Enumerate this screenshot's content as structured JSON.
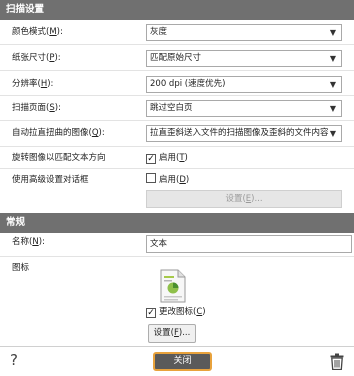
{
  "scan_settings": {
    "header": "扫描设置",
    "color_mode": {
      "label": "颜色模式(",
      "key": "M",
      "suffix": "):",
      "value": "灰度"
    },
    "paper_size": {
      "label": "纸张尺寸(",
      "key": "P",
      "suffix": "):",
      "value": "匹配原始尺寸"
    },
    "resolution": {
      "label": "分辨率(",
      "key": "H",
      "suffix": "):",
      "value": "200 dpi  (速度优先)"
    },
    "scan_pages": {
      "label": "扫描页面(",
      "key": "S",
      "suffix": "):",
      "value": "跳过空白页"
    },
    "auto_straighten": {
      "label": "自动拉直扭曲的图像(",
      "key": "Q",
      "suffix": "):",
      "value": "拉直歪斜送入文件的扫描图像及歪斜的文件内容"
    },
    "rotate": {
      "label": "旋转图像以匹配文本方向",
      "check_label": "启用(",
      "check_key": "T",
      "check_suffix": ")",
      "checked": true
    },
    "advanced": {
      "label": "使用高级设置对话框",
      "check_label": "启用(",
      "check_key": "D",
      "check_suffix": ")",
      "checked": false,
      "settings_button": "设置(",
      "settings_key": "E",
      "settings_suffix": ")..."
    }
  },
  "general": {
    "header": "常规",
    "name": {
      "label": "名称(",
      "key": "N",
      "suffix": "):",
      "value": "文本"
    },
    "icon": {
      "label": "图标",
      "change_label": "更改图标(",
      "change_key": "C",
      "change_suffix": ")",
      "change_checked": true,
      "settings_button": "设置(",
      "settings_key": "F",
      "settings_suffix": ")..."
    }
  },
  "footer": {
    "help": "?",
    "close": "关闭"
  }
}
